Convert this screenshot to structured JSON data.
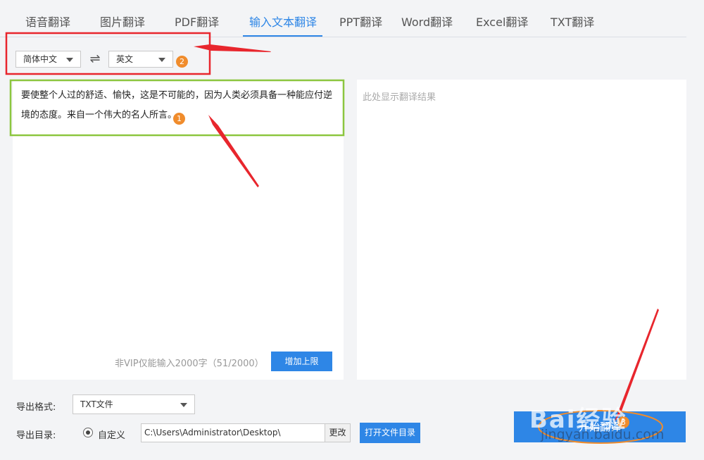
{
  "tabs": [
    {
      "label": "语音翻译"
    },
    {
      "label": "图片翻译"
    },
    {
      "label": "PDF翻译"
    },
    {
      "label": "输入文本翻译",
      "active": true
    },
    {
      "label": "PPT翻译"
    },
    {
      "label": "Word翻译"
    },
    {
      "label": "Excel翻译"
    },
    {
      "label": "TXT翻译"
    }
  ],
  "languages": {
    "source": "简体中文",
    "target": "英文",
    "swap_icon": "⇌"
  },
  "input": {
    "text": "要使整个人过的舒适、愉快，这是不可能的，因为人类必须具备一种能应付逆境的态度。来自一个伟大的名人所言。",
    "counter": "非VIP仅能输入2000字（51/2000）",
    "increase_limit_label": "增加上限"
  },
  "output": {
    "placeholder": "此处显示翻译结果"
  },
  "export": {
    "format_label": "导出格式:",
    "format_value": "TXT文件",
    "dir_label": "导出目录:",
    "custom_label": "自定义",
    "path": "C:\\Users\\Administrator\\Desktop\\",
    "change_label": "更改",
    "open_dir_label": "打开文件目录"
  },
  "start_button_label": "开始翻译",
  "annotations": {
    "badge1": "1",
    "badge2": "2",
    "badge3": "3"
  },
  "watermark": {
    "brand": "Bai经验",
    "url": "jingyan.baidu.com"
  },
  "colors": {
    "accent": "#2e86e6",
    "annotation_red": "#e8262d",
    "annotation_green": "#8cc63f",
    "badge_orange": "#f08c2c"
  }
}
